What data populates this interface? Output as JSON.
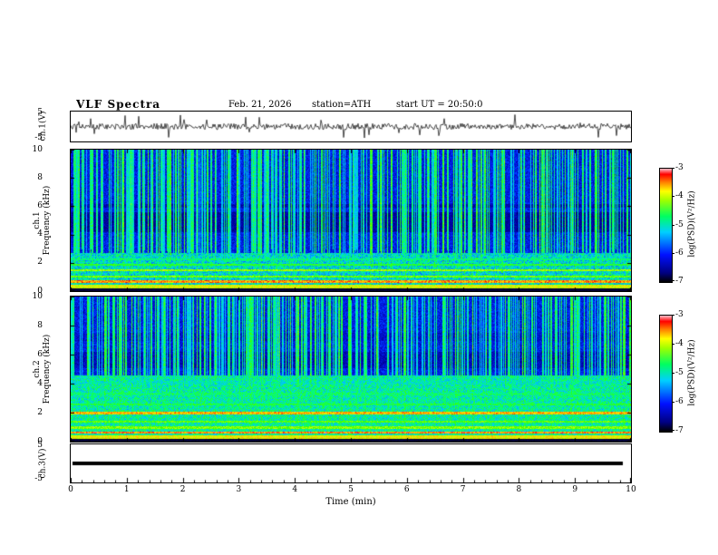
{
  "header": {
    "title": "VLF Spectra",
    "date": "Feb. 21, 2026",
    "station": "station=ATH",
    "start_ut": "start UT =  20:50:0"
  },
  "xaxis": {
    "label": "Time (min)",
    "lim": [
      0,
      10
    ],
    "ticks": [
      0,
      1,
      2,
      3,
      4,
      5,
      6,
      7,
      8,
      9,
      10
    ]
  },
  "chart_data": [
    {
      "type": "line",
      "name": "ch1-waveform",
      "ylabel": "ch.1(V)",
      "ylim": [
        -5,
        5
      ],
      "yticks": [
        5,
        -5
      ],
      "description": "broadband noise around 0 V with impulsive sferic spikes",
      "render": {
        "seed": 5,
        "amplitude": 1.0,
        "spike_rate": 0.04,
        "spike_amp": 4.0
      }
    },
    {
      "type": "heatmap",
      "name": "ch1-spectrogram",
      "ylabel_line1": "ch.1",
      "ylabel_line2": "Frequency (kHz)",
      "ylim": [
        0,
        10
      ],
      "yticks": [
        0,
        2,
        4,
        6,
        8,
        10
      ],
      "colorbar": {
        "label": "log(PSD)(V²/Hz)",
        "lim": [
          -7,
          -3
        ],
        "ticks": [
          -3,
          -4,
          -5,
          -6,
          -7
        ]
      },
      "description": "VLF spectrogram: blue background above ~3 kHz pierced by vertical broadband sferic streaks; bright green/yellow horizontal emission bands below ~2.5 kHz; dark strip near 0 kHz",
      "render": {
        "seed": 11,
        "sferic_density": 0.5,
        "low_cut": 2.7,
        "low_bg": 0.48,
        "high_bg": 0.3,
        "bands": [
          {
            "f": 0.35,
            "w": 0.1,
            "v": 0.8
          },
          {
            "f": 0.7,
            "w": 0.08,
            "v": 0.9
          },
          {
            "f": 1.05,
            "w": 0.07,
            "v": 0.7
          },
          {
            "f": 1.5,
            "w": 0.08,
            "v": 0.74
          },
          {
            "f": 1.9,
            "w": 0.07,
            "v": 0.62
          },
          {
            "f": 2.3,
            "w": 0.06,
            "v": 0.55
          }
        ],
        "dips": [
          {
            "f0": 4.2,
            "f1": 5.6,
            "v": 0.22
          },
          {
            "f0": 5.9,
            "f1": 6.2,
            "v": 0.24
          }
        ]
      }
    },
    {
      "type": "heatmap",
      "name": "ch2-spectrogram",
      "ylabel_line1": "ch.2",
      "ylabel_line2": "Frequency (kHz)",
      "ylim": [
        0,
        10
      ],
      "yticks": [
        0,
        2,
        4,
        6,
        8,
        10
      ],
      "colorbar": {
        "label": "log(PSD)(V²/Hz)",
        "lim": [
          -7,
          -3
        ],
        "ticks": [
          -3,
          -4,
          -5,
          -6,
          -7
        ]
      },
      "description": "VLF spectrogram: similar sferic streaks above ~5 kHz; strong green/yellow emission bands up to ~4.5 kHz including bright yellow line near 2 kHz; dark strip near 0 kHz",
      "render": {
        "seed": 29,
        "sferic_density": 0.5,
        "low_cut": 4.6,
        "low_bg": 0.52,
        "high_bg": 0.3,
        "bands": [
          {
            "f": 0.35,
            "w": 0.1,
            "v": 0.82
          },
          {
            "f": 0.65,
            "w": 0.08,
            "v": 0.92
          },
          {
            "f": 1.0,
            "w": 0.07,
            "v": 0.72
          },
          {
            "f": 1.4,
            "w": 0.07,
            "v": 0.68
          },
          {
            "f": 2.0,
            "w": 0.1,
            "v": 0.88
          },
          {
            "f": 2.6,
            "w": 0.07,
            "v": 0.6
          },
          {
            "f": 3.3,
            "w": 0.08,
            "v": 0.56
          },
          {
            "f": 4.1,
            "w": 0.12,
            "v": 0.5
          }
        ],
        "dips": [
          {
            "f0": 5.1,
            "f1": 6.2,
            "v": 0.25
          },
          {
            "f0": 7.0,
            "f1": 7.5,
            "v": 0.27
          }
        ]
      }
    },
    {
      "type": "line",
      "name": "ch3-waveform",
      "ylabel": "ch.3(V)",
      "ylim": [
        -5,
        5
      ],
      "yticks": [
        5,
        -5
      ],
      "description": "flat (zero / saturated) trace at 0 V for the whole interval",
      "value": 0
    }
  ]
}
